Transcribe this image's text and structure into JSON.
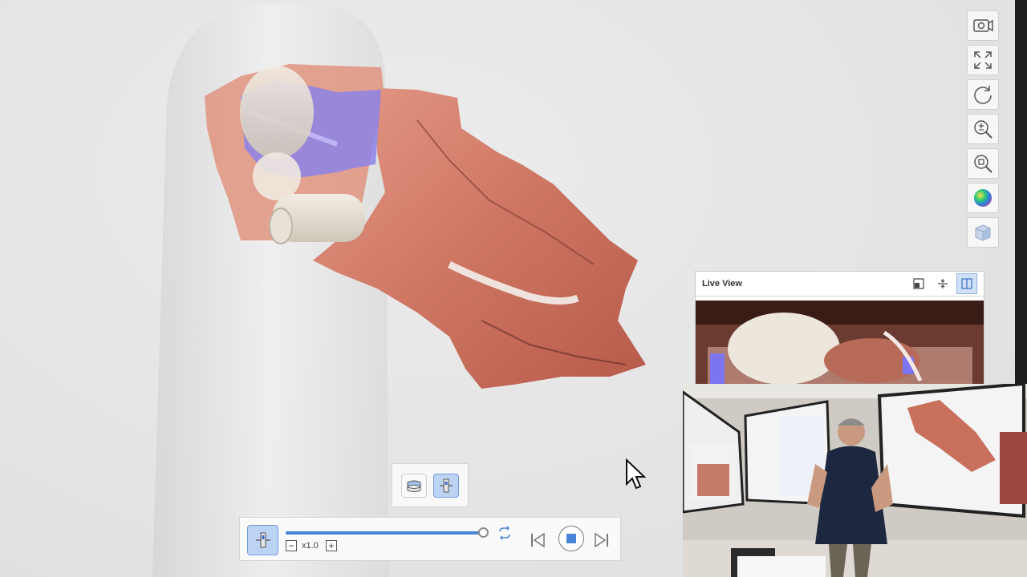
{
  "app": {
    "window_title": ""
  },
  "toolbar_right": {
    "items": [
      {
        "name": "screenshot-icon",
        "label": "Screenshot"
      },
      {
        "name": "fit-view-icon",
        "label": "Fit to screen"
      },
      {
        "name": "reset-rotation-icon",
        "label": "Reset view"
      },
      {
        "name": "zoom-in-out-icon",
        "label": "Zoom"
      },
      {
        "name": "zoom-region-icon",
        "label": "Zoom to region"
      },
      {
        "name": "color-map-icon",
        "label": "Color map"
      },
      {
        "name": "cube-view-icon",
        "label": "View orientation"
      }
    ]
  },
  "live_view": {
    "title": "Live View",
    "icons": [
      "picture-in-picture-icon",
      "split-vertical-icon",
      "panel-layout-icon"
    ],
    "active_icon": "panel-layout-icon"
  },
  "mode_selector": {
    "items": [
      {
        "name": "denture-mode-icon",
        "active": false
      },
      {
        "name": "scan-body-mode-icon",
        "active": true
      }
    ]
  },
  "playback": {
    "speed_label": "x1.0",
    "progress": 1.0,
    "minus_label": "−",
    "plus_label": "+"
  },
  "colors": {
    "accent": "#4a84d8",
    "active_bg": "#bcd3f3",
    "tissue": "#d07a66",
    "scan_body": "#8c82e8"
  }
}
